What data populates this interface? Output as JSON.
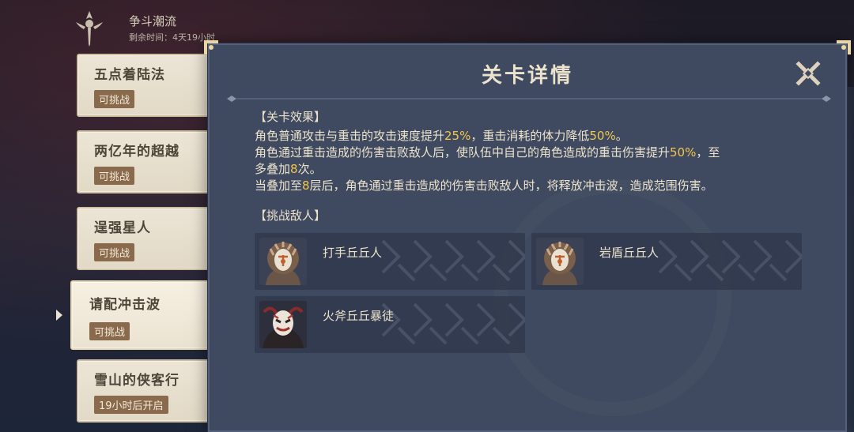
{
  "event": {
    "title": "争斗潮流",
    "timer": "剩余时间：4天19小时"
  },
  "levels": [
    {
      "name": "五点着陆法",
      "status": "可挑战"
    },
    {
      "name": "两亿年的超越",
      "status": "可挑战"
    },
    {
      "name": "逞强星人",
      "status": "可挑战"
    },
    {
      "name": "请配冲击波",
      "status": "可挑战",
      "selected": true
    },
    {
      "name": "雪山的侠客行",
      "status": "19小时后开启"
    }
  ],
  "dialog": {
    "title": "关卡详情",
    "effect_header": "【关卡效果】",
    "effect_lines": [
      [
        {
          "t": "角色普通攻击与重击的攻击速度提升"
        },
        {
          "t": "25%",
          "hl": true
        },
        {
          "t": "，重击消耗的体力降低"
        },
        {
          "t": "50%",
          "hl": true
        },
        {
          "t": "。"
        }
      ],
      [
        {
          "t": "角色通过重击造成的伤害击败敌人后，使队伍中自己的角色造成的重击伤害提升"
        },
        {
          "t": "50%",
          "hl": true
        },
        {
          "t": "，至"
        }
      ],
      [
        {
          "t": "多叠加"
        },
        {
          "t": "8",
          "hl": true
        },
        {
          "t": "次。"
        }
      ],
      [
        {
          "t": "当叠加至"
        },
        {
          "t": "8",
          "hl": true
        },
        {
          "t": "层后，角色通过重击造成的伤害击败敌人时，将释放冲击波，造成范围伤害。"
        }
      ]
    ],
    "enemies_header": "【挑战敌人】",
    "enemies": [
      {
        "name": "打手丘丘人",
        "icon": "hilichurl-fighter-icon"
      },
      {
        "name": "岩盾丘丘人",
        "icon": "hilichurl-rock-shield-icon"
      },
      {
        "name": "火斧丘丘暴徒",
        "icon": "hilichurl-blazing-axe-mitachurl-icon"
      }
    ]
  },
  "colors": {
    "highlight": "#f2c64a",
    "text": "#ece3cc",
    "status_badge": "#8a6a4c"
  }
}
